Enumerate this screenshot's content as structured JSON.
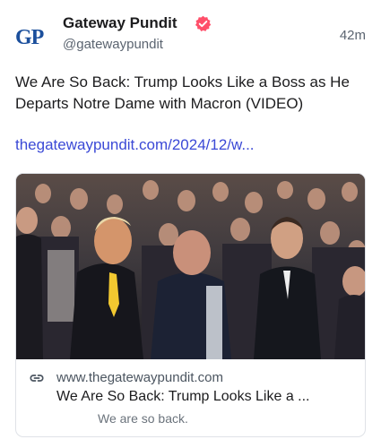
{
  "post": {
    "author": {
      "avatar_text": "GP",
      "display_name": "Gateway Pundit",
      "handle": "@gatewaypundit",
      "verified": true,
      "verified_color": "#ff4f6a"
    },
    "time": "42m",
    "text": "We Are So Back: Trump Looks Like a Boss as He Departs Notre Dame with Macron (VIDEO)",
    "link_text": "thegatewaypundit.com/2024/12/w...",
    "link_color": "#3b49d6"
  },
  "card": {
    "link_icon": "link-icon",
    "domain": "www.thegatewaypundit.com",
    "title": "We Are So Back: Trump Looks Like a ...",
    "description": "We are so back."
  }
}
